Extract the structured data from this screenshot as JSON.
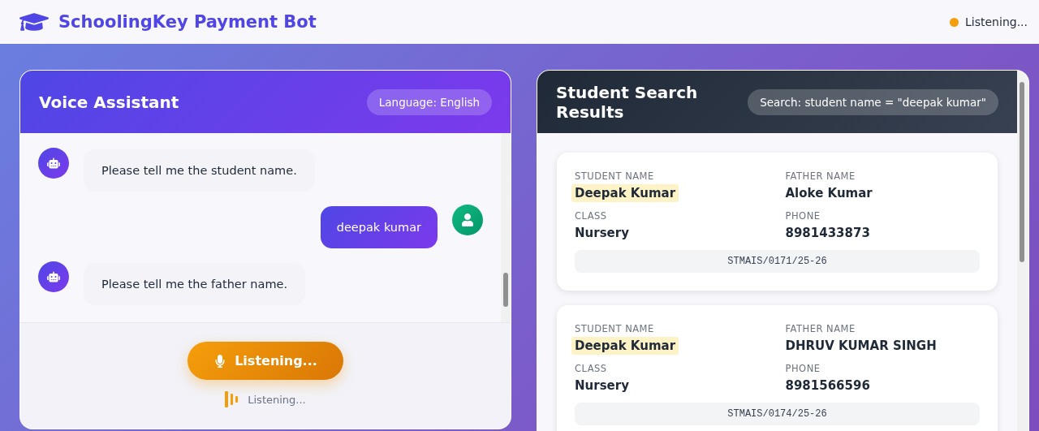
{
  "app": {
    "title": "SchoolingKey Payment Bot",
    "status": "Listening...",
    "listening": true
  },
  "voice_panel": {
    "title": "Voice Assistant",
    "language": "Language: English",
    "messages": [
      {
        "kind": "bot",
        "text": "Please tell me the student name."
      },
      {
        "kind": "user",
        "text": "deepak kumar"
      },
      {
        "kind": "bot",
        "text": "Please tell me the father name."
      }
    ],
    "mic_button": "Listening...",
    "status": "Listening..."
  },
  "results_panel": {
    "title": "Student Search Results",
    "query": "Search: student name = \"deepak kumar\"",
    "students": [
      {
        "fields": [
          {
            "label": "STUDENT NAME",
            "value": "Deepak Kumar",
            "highlighted": true
          },
          {
            "label": "FATHER NAME",
            "value": "Aloke Kumar",
            "highlighted": false
          },
          {
            "label": "CLASS",
            "value": "Nursery",
            "highlighted": false
          },
          {
            "label": "PHONE",
            "value": "8981433873",
            "highlighted": false
          }
        ],
        "id": "STMAIS/0171/25-26"
      },
      {
        "fields": [
          {
            "label": "STUDENT NAME",
            "value": "Deepak Kumar",
            "highlighted": true
          },
          {
            "label": "FATHER NAME",
            "value": "DHRUV KUMAR SINGH",
            "highlighted": false
          },
          {
            "label": "CLASS",
            "value": "Nursery",
            "highlighted": false
          },
          {
            "label": "PHONE",
            "value": "8981566596",
            "highlighted": false
          }
        ],
        "id": "STMAIS/0174/25-26"
      }
    ]
  }
}
